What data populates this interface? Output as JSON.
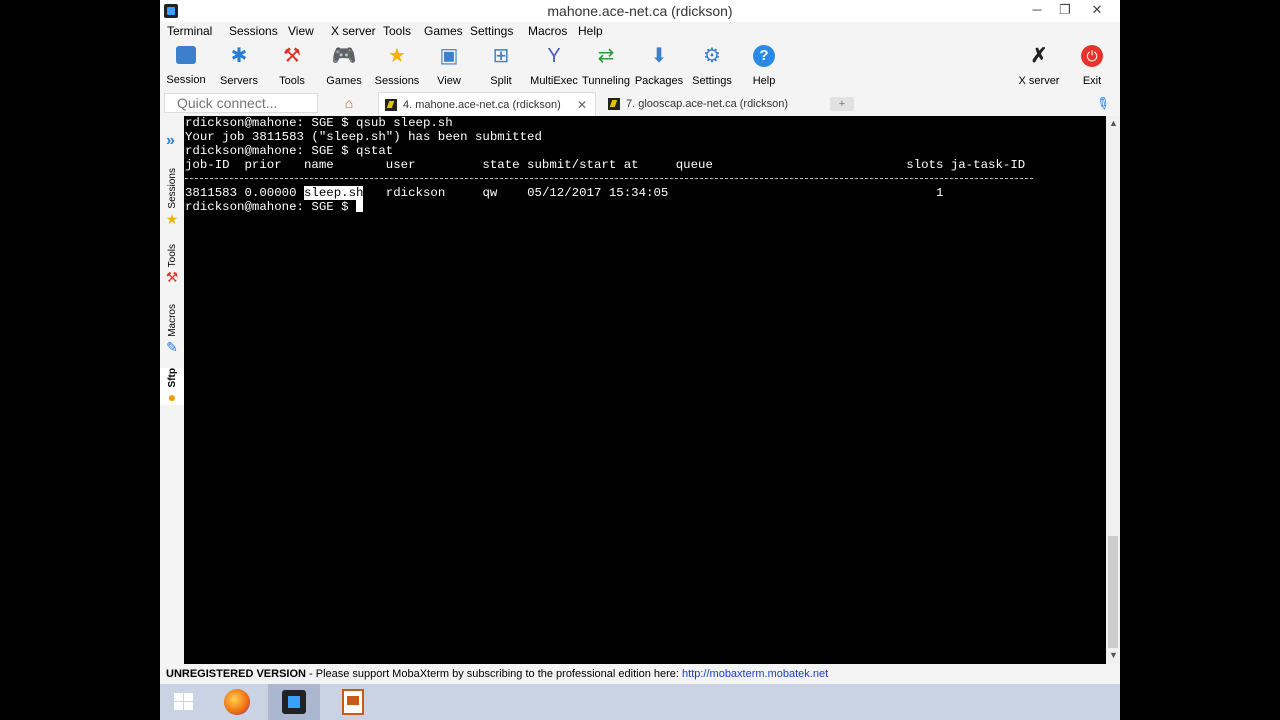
{
  "window": {
    "title": "mahone.ace-net.ca (rdickson)",
    "controls": {
      "minimize": "─",
      "maximize": "❐",
      "close": "✕"
    }
  },
  "menubar": {
    "items": [
      "Terminal",
      "Sessions",
      "View",
      "X server",
      "Tools",
      "Games",
      "Settings",
      "Macros",
      "Help"
    ]
  },
  "toolbar": {
    "items": [
      {
        "label": "Session",
        "icon": "session-icon"
      },
      {
        "label": "Servers",
        "icon": "servers-icon"
      },
      {
        "label": "Tools",
        "icon": "tools-icon"
      },
      {
        "label": "Games",
        "icon": "games-icon"
      },
      {
        "label": "Sessions",
        "icon": "star-icon"
      },
      {
        "label": "View",
        "icon": "view-icon"
      },
      {
        "label": "Split",
        "icon": "split-icon"
      },
      {
        "label": "MultiExec",
        "icon": "multiexec-icon"
      },
      {
        "label": "Tunneling",
        "icon": "tunneling-icon"
      },
      {
        "label": "Packages",
        "icon": "packages-icon"
      },
      {
        "label": "Settings",
        "icon": "gear-icon"
      },
      {
        "label": "Help",
        "icon": "help-icon"
      },
      {
        "label": "X server",
        "icon": "xserver-icon"
      },
      {
        "label": "Exit",
        "icon": "power-icon"
      }
    ]
  },
  "tabs": {
    "quick_connect_placeholder": "Quick connect...",
    "items": [
      {
        "label": "4. mahone.ace-net.ca (rdickson)",
        "active": true
      },
      {
        "label": "7. glooscap.ace-net.ca (rdickson)",
        "active": false
      }
    ]
  },
  "sidebar": {
    "items": [
      "Sessions",
      "Tools",
      "Macros",
      "Sftp"
    ]
  },
  "terminal": {
    "lines": [
      "rdickson@mahone: SGE $ qsub sleep.sh",
      "Your job 3811583 (\"sleep.sh\") has been submitted",
      "rdickson@mahone: SGE $ qstat",
      "job-ID  prior   name       user         state submit/start at     queue                          slots ja-task-ID"
    ],
    "job_row_prefix": "3811583 0.00000 ",
    "job_row_selected": "sleep.sh",
    "job_row_suffix": "   rdickson     qw    05/12/2017 15:34:05                                    1",
    "prompt": "rdickson@mahone: SGE $ "
  },
  "statusbar": {
    "unregistered": "UNREGISTERED VERSION",
    "message": "  -  Please support MobaXterm by subscribing to the professional edition here: ",
    "link": "http://mobaxterm.mobatek.net"
  }
}
